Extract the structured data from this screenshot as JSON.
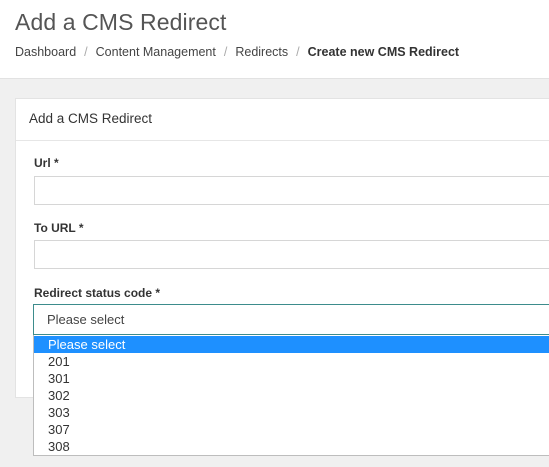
{
  "header": {
    "title": "Add a CMS Redirect",
    "breadcrumb": [
      "Dashboard",
      "Content Management",
      "Redirects",
      "Create new CMS Redirect"
    ],
    "separator": "/"
  },
  "form": {
    "card_title": "Add a CMS Redirect",
    "url_label": "Url *",
    "url_value": "",
    "to_url_label": "To URL *",
    "to_url_value": "",
    "status_label": "Redirect status code *",
    "status_selected": "Please select",
    "status_options": [
      "Please select",
      "201",
      "301",
      "302",
      "303",
      "307",
      "308"
    ]
  },
  "colors": {
    "highlight": "#1e90ff",
    "focus_border": "#3d8c8c"
  }
}
